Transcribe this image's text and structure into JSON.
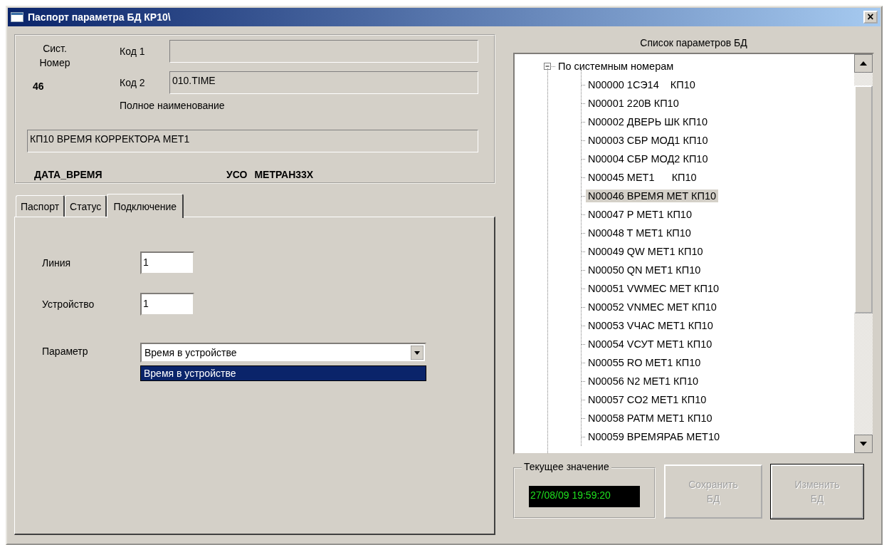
{
  "window": {
    "title": "Паспорт параметра БД КР10\\",
    "close": "×"
  },
  "header": {
    "sys_label": "Сист. Номер",
    "sys_number": "46",
    "code1_label": "Код 1",
    "code2_label": "Код 2",
    "code2_value": "010.TIME",
    "fullname_label": "Полное наименование",
    "fullname_value": "КП10 ВРЕМЯ КОРРЕКТОРА МЕТ1",
    "type": "ДАТА_ВРЕМЯ",
    "uso_label": "УСО",
    "uso_value": "МЕТРАН33Х"
  },
  "tabs": [
    {
      "label": "Паспорт",
      "selected": false
    },
    {
      "label": "Статус",
      "selected": false
    },
    {
      "label": "Подключение",
      "selected": true
    }
  ],
  "connection": {
    "line_label": "Линия",
    "line_value": "1",
    "device_label": "Устройство",
    "device_value": "1",
    "parameter_label": "Параметр",
    "parameter_value": "Время в устройстве",
    "dropdown_open": true,
    "options": [
      {
        "label": "Время в устройстве",
        "selected": true
      }
    ]
  },
  "tree": {
    "title": "Список параметров БД",
    "root": {
      "label": "По системным номерам",
      "expanded": true,
      "children": [
        {
          "label": "N00000 1СЭ14    КП10",
          "selected": false
        },
        {
          "label": "N00001 220В КП10",
          "selected": false
        },
        {
          "label": "N00002 ДВЕРЬ ШК КП10",
          "selected": false
        },
        {
          "label": "N00003 СБР МОД1 КП10",
          "selected": false
        },
        {
          "label": "N00004 СБР МОД2 КП10",
          "selected": false
        },
        {
          "label": "N00045 МЕТ1      КП10",
          "selected": false
        },
        {
          "label": "N00046 ВРЕМЯ МЕТ КП10",
          "selected": true
        },
        {
          "label": "N00047 P МЕТ1 КП10",
          "selected": false
        },
        {
          "label": "N00048 T МЕТ1 КП10",
          "selected": false
        },
        {
          "label": "N00049 QW МЕТ1 КП10",
          "selected": false
        },
        {
          "label": "N00050 QN МЕТ1 КП10",
          "selected": false
        },
        {
          "label": "N00051 VWMEC МЕТ КП10",
          "selected": false
        },
        {
          "label": "N00052 VNMEC МЕТ КП10",
          "selected": false
        },
        {
          "label": "N00053 VЧАС МЕТ1 КП10",
          "selected": false
        },
        {
          "label": "N00054 VСУТ МЕТ1 КП10",
          "selected": false
        },
        {
          "label": "N00055 RO МЕТ1 КП10",
          "selected": false
        },
        {
          "label": "N00056 N2 МЕТ1 КП10",
          "selected": false
        },
        {
          "label": "N00057 CO2 МЕТ1 КП10",
          "selected": false
        },
        {
          "label": "N00058 PATM МЕТ1 КП10",
          "selected": false
        },
        {
          "label": "N00059 ВРЕМЯРАБ МЕТ10",
          "selected": false
        }
      ]
    }
  },
  "current_value": {
    "label": "Текущее значение",
    "value": "27/08/09 19:59:20"
  },
  "buttons": [
    {
      "label": "Сохранить БД",
      "disabled": true,
      "default": false
    },
    {
      "label": "Изменить БД",
      "disabled": true,
      "default": true
    }
  ]
}
